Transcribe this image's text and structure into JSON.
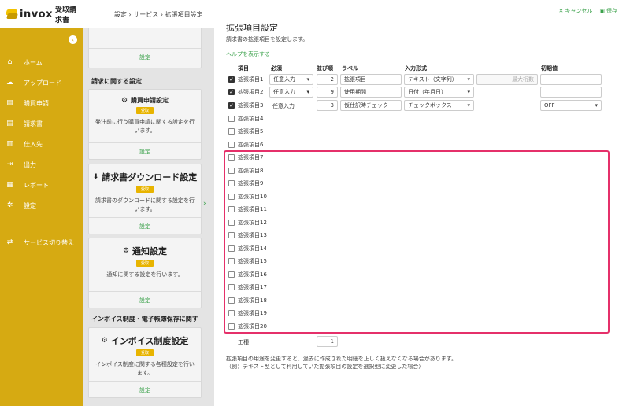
{
  "app": {
    "logo_text": "invox",
    "logo_sub": "受取請求書",
    "breadcrumb": "設定 › サービス › 拡張項目設定"
  },
  "sidebar": {
    "collapse_icon": "chevron-left-icon",
    "items": [
      {
        "label": "ホーム",
        "icon": "home-icon"
      },
      {
        "label": "アップロード",
        "icon": "cloud-upload-icon"
      },
      {
        "label": "購買申請",
        "icon": "document-icon"
      },
      {
        "label": "請求書",
        "icon": "document-icon"
      },
      {
        "label": "仕入先",
        "icon": "building-icon"
      },
      {
        "label": "出力",
        "icon": "export-icon"
      },
      {
        "label": "レポート",
        "icon": "chart-icon"
      },
      {
        "label": "設定",
        "icon": "gear-icon"
      }
    ],
    "switch_service": {
      "label": "サービス切り替え",
      "icon": "switch-icon"
    }
  },
  "settings_column": {
    "top_link": "設定",
    "section1": "請求に関する設定",
    "section2": "インボイス制度・電子帳簿保存に関す",
    "cards": [
      {
        "title": "購買申請設定",
        "badge": "受取",
        "desc": "発注前に行う購買申請に関する設定を行います。",
        "link": "設定"
      },
      {
        "title": "請求書ダウンロード設定",
        "badge": "受取",
        "desc": "請求書のダウンロードに関する設定を行います。",
        "link": "設定"
      },
      {
        "title": "通知設定",
        "badge": "受取",
        "desc": "通知に関する設定を行います。",
        "link": "設定"
      },
      {
        "title": "インボイス制度設定",
        "badge": "受取",
        "desc": "インボイス制度に関する各種設定を行います。",
        "link": "設定"
      }
    ]
  },
  "panel": {
    "cancel_label": "キャンセル",
    "save_label": "保存",
    "title": "拡張項目設定",
    "description": "請求書の拡張項目を設定します。",
    "help_link": "ヘルプを表示する",
    "columns": {
      "item": "項目",
      "required": "必須",
      "order": "並び順",
      "label": "ラベル",
      "input_type": "入力形式",
      "default": "初期値"
    },
    "active_rows": [
      {
        "name": "拡張項目1",
        "checked": true,
        "required": "任意入力",
        "order": "2",
        "label": "拡張項目",
        "input_type": "テキスト（文字列）",
        "max_placeholder": "最大桁数",
        "default": ""
      },
      {
        "name": "拡張項目2",
        "checked": true,
        "required": "任意入力",
        "order": "9",
        "label": "使用期間",
        "input_type": "日付（年月日）",
        "default": ""
      },
      {
        "name": "拡張項目3",
        "checked": true,
        "required": "任意入力",
        "order": "3",
        "label": "仮仕訳時チェック",
        "input_type": "チェックボックス",
        "default": "OFF"
      }
    ],
    "inactive_rows": [
      "拡張項目4",
      "拡張項目5",
      "拡張項目6",
      "拡張項目7",
      "拡張項目8",
      "拡張項目9",
      "拡張項目10",
      "拡張項目11",
      "拡張項目12",
      "拡張項目13",
      "拡張項目14",
      "拡張項目15",
      "拡張項目16",
      "拡張項目17",
      "拡張項目18",
      "拡張項目19",
      "拡張項目20"
    ],
    "work_label": "工種",
    "work_order": "1",
    "note_line1": "拡張項目の用途を変更すると、過去に作成された明細を正しく扱えなくなる場合があります。",
    "note_line2": "（例：テキスト型として利用していた拡張項目の設定を選択型に変更した場合）",
    "highlight_color": "#e5306a",
    "accent_color": "#3aa14a"
  }
}
